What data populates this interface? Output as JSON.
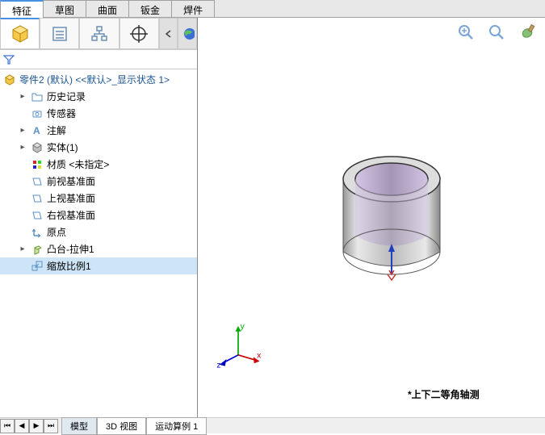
{
  "tabs": {
    "feature": "特征",
    "sketch": "草图",
    "surface": "曲面",
    "sheetmetal": "钣金",
    "weldment": "焊件"
  },
  "tree": {
    "root": "零件2 (默认) <<默认>_显示状态 1>",
    "history": "历史记录",
    "sensors": "传感器",
    "annotations": "注解",
    "solids": "实体(1)",
    "material": "材质 <未指定>",
    "front_plane": "前视基准面",
    "top_plane": "上视基准面",
    "right_plane": "右视基准面",
    "origin": "原点",
    "extrude": "凸台-拉伸1",
    "scale": "缩放比例1"
  },
  "view_label": "*上下二等角轴测",
  "triad": {
    "x": "x",
    "y": "y",
    "z": "z"
  },
  "bottom_tabs": {
    "model": "模型",
    "view3d": "3D 视图",
    "motion": "运动算例 1"
  }
}
